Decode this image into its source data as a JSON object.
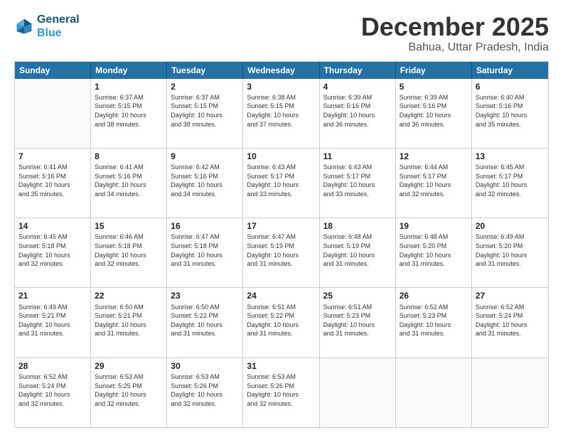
{
  "header": {
    "logo_line1": "General",
    "logo_line2": "Blue",
    "month": "December 2025",
    "location": "Bahua, Uttar Pradesh, India"
  },
  "days_of_week": [
    "Sunday",
    "Monday",
    "Tuesday",
    "Wednesday",
    "Thursday",
    "Friday",
    "Saturday"
  ],
  "weeks": [
    [
      {
        "day": "",
        "text": ""
      },
      {
        "day": "1",
        "text": "Sunrise: 6:37 AM\nSunset: 5:15 PM\nDaylight: 10 hours\nand 38 minutes."
      },
      {
        "day": "2",
        "text": "Sunrise: 6:37 AM\nSunset: 5:15 PM\nDaylight: 10 hours\nand 38 minutes."
      },
      {
        "day": "3",
        "text": "Sunrise: 6:38 AM\nSunset: 5:15 PM\nDaylight: 10 hours\nand 37 minutes."
      },
      {
        "day": "4",
        "text": "Sunrise: 6:39 AM\nSunset: 5:16 PM\nDaylight: 10 hours\nand 36 minutes."
      },
      {
        "day": "5",
        "text": "Sunrise: 6:39 AM\nSunset: 5:16 PM\nDaylight: 10 hours\nand 36 minutes."
      },
      {
        "day": "6",
        "text": "Sunrise: 6:40 AM\nSunset: 5:16 PM\nDaylight: 10 hours\nand 35 minutes."
      }
    ],
    [
      {
        "day": "7",
        "text": "Sunrise: 6:41 AM\nSunset: 5:16 PM\nDaylight: 10 hours\nand 35 minutes."
      },
      {
        "day": "8",
        "text": "Sunrise: 6:41 AM\nSunset: 5:16 PM\nDaylight: 10 hours\nand 34 minutes."
      },
      {
        "day": "9",
        "text": "Sunrise: 6:42 AM\nSunset: 5:16 PM\nDaylight: 10 hours\nand 34 minutes."
      },
      {
        "day": "10",
        "text": "Sunrise: 6:43 AM\nSunset: 5:17 PM\nDaylight: 10 hours\nand 33 minutes."
      },
      {
        "day": "11",
        "text": "Sunrise: 6:43 AM\nSunset: 5:17 PM\nDaylight: 10 hours\nand 33 minutes."
      },
      {
        "day": "12",
        "text": "Sunrise: 6:44 AM\nSunset: 5:17 PM\nDaylight: 10 hours\nand 32 minutes."
      },
      {
        "day": "13",
        "text": "Sunrise: 6:45 AM\nSunset: 5:17 PM\nDaylight: 10 hours\nand 32 minutes."
      }
    ],
    [
      {
        "day": "14",
        "text": "Sunrise: 6:45 AM\nSunset: 5:18 PM\nDaylight: 10 hours\nand 32 minutes."
      },
      {
        "day": "15",
        "text": "Sunrise: 6:46 AM\nSunset: 5:18 PM\nDaylight: 10 hours\nand 32 minutes."
      },
      {
        "day": "16",
        "text": "Sunrise: 6:47 AM\nSunset: 5:18 PM\nDaylight: 10 hours\nand 31 minutes."
      },
      {
        "day": "17",
        "text": "Sunrise: 6:47 AM\nSunset: 5:19 PM\nDaylight: 10 hours\nand 31 minutes."
      },
      {
        "day": "18",
        "text": "Sunrise: 6:48 AM\nSunset: 5:19 PM\nDaylight: 10 hours\nand 31 minutes."
      },
      {
        "day": "19",
        "text": "Sunrise: 6:48 AM\nSunset: 5:20 PM\nDaylight: 10 hours\nand 31 minutes."
      },
      {
        "day": "20",
        "text": "Sunrise: 6:49 AM\nSunset: 5:20 PM\nDaylight: 10 hours\nand 31 minutes."
      }
    ],
    [
      {
        "day": "21",
        "text": "Sunrise: 6:49 AM\nSunset: 5:21 PM\nDaylight: 10 hours\nand 31 minutes."
      },
      {
        "day": "22",
        "text": "Sunrise: 6:50 AM\nSunset: 5:21 PM\nDaylight: 10 hours\nand 31 minutes."
      },
      {
        "day": "23",
        "text": "Sunrise: 6:50 AM\nSunset: 5:22 PM\nDaylight: 10 hours\nand 31 minutes."
      },
      {
        "day": "24",
        "text": "Sunrise: 6:51 AM\nSunset: 5:22 PM\nDaylight: 10 hours\nand 31 minutes."
      },
      {
        "day": "25",
        "text": "Sunrise: 6:51 AM\nSunset: 5:23 PM\nDaylight: 10 hours\nand 31 minutes."
      },
      {
        "day": "26",
        "text": "Sunrise: 6:52 AM\nSunset: 5:23 PM\nDaylight: 10 hours\nand 31 minutes."
      },
      {
        "day": "27",
        "text": "Sunrise: 6:52 AM\nSunset: 5:24 PM\nDaylight: 10 hours\nand 31 minutes."
      }
    ],
    [
      {
        "day": "28",
        "text": "Sunrise: 6:52 AM\nSunset: 5:24 PM\nDaylight: 10 hours\nand 32 minutes."
      },
      {
        "day": "29",
        "text": "Sunrise: 6:53 AM\nSunset: 5:25 PM\nDaylight: 10 hours\nand 32 minutes."
      },
      {
        "day": "30",
        "text": "Sunrise: 6:53 AM\nSunset: 5:26 PM\nDaylight: 10 hours\nand 32 minutes."
      },
      {
        "day": "31",
        "text": "Sunrise: 6:53 AM\nSunset: 5:26 PM\nDaylight: 10 hours\nand 32 minutes."
      },
      {
        "day": "",
        "text": ""
      },
      {
        "day": "",
        "text": ""
      },
      {
        "day": "",
        "text": ""
      }
    ]
  ]
}
